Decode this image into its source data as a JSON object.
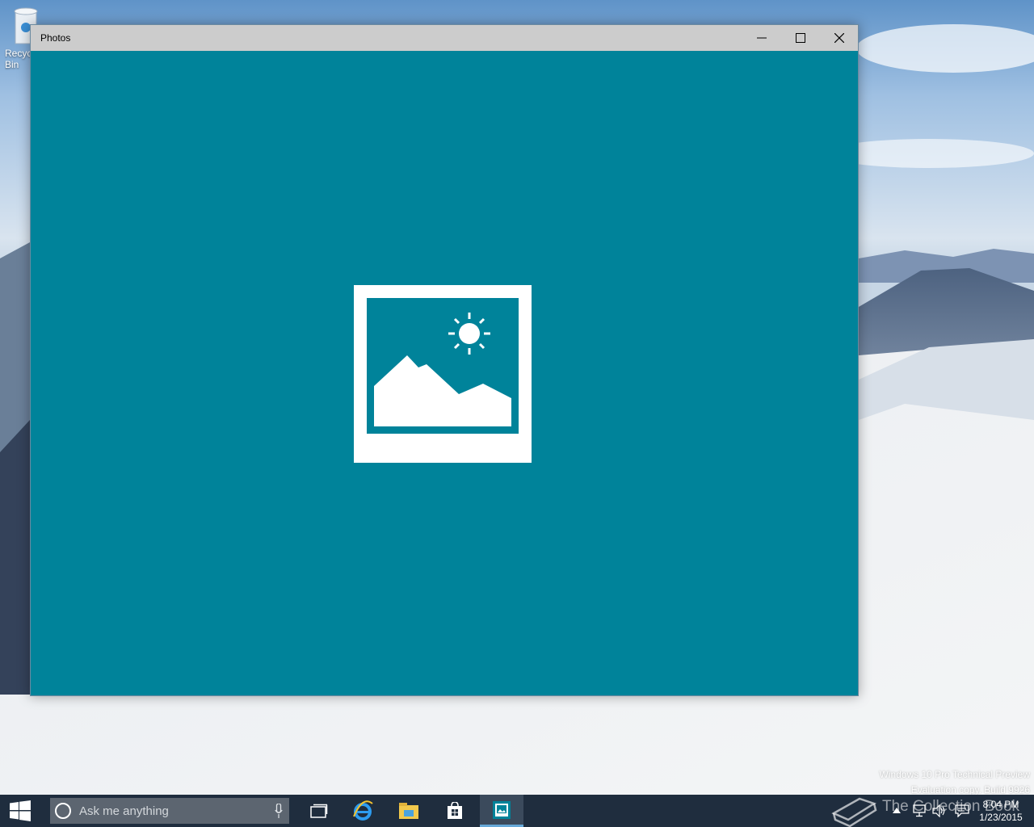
{
  "desktop": {
    "recycle_bin_label": "Recycle Bin"
  },
  "window": {
    "title": "Photos",
    "content_color": "#00839a",
    "titlebar_color": "#cccccc",
    "controls": {
      "minimize_icon": "minimize-icon",
      "maximize_icon": "maximize-icon",
      "close_icon": "close-icon"
    }
  },
  "watermark": {
    "line1": "Windows 10 Pro Technical Preview",
    "line2": "Evaluation copy. Build 9926"
  },
  "taskbar": {
    "search_placeholder": "Ask me anything",
    "apps": [
      "task-view",
      "internet-explorer",
      "file-explorer",
      "store",
      "photos"
    ],
    "active_app": "photos",
    "clock_time": "8:04 PM",
    "clock_date": "1/23/2015",
    "overlay_text": "The Collection Book"
  }
}
